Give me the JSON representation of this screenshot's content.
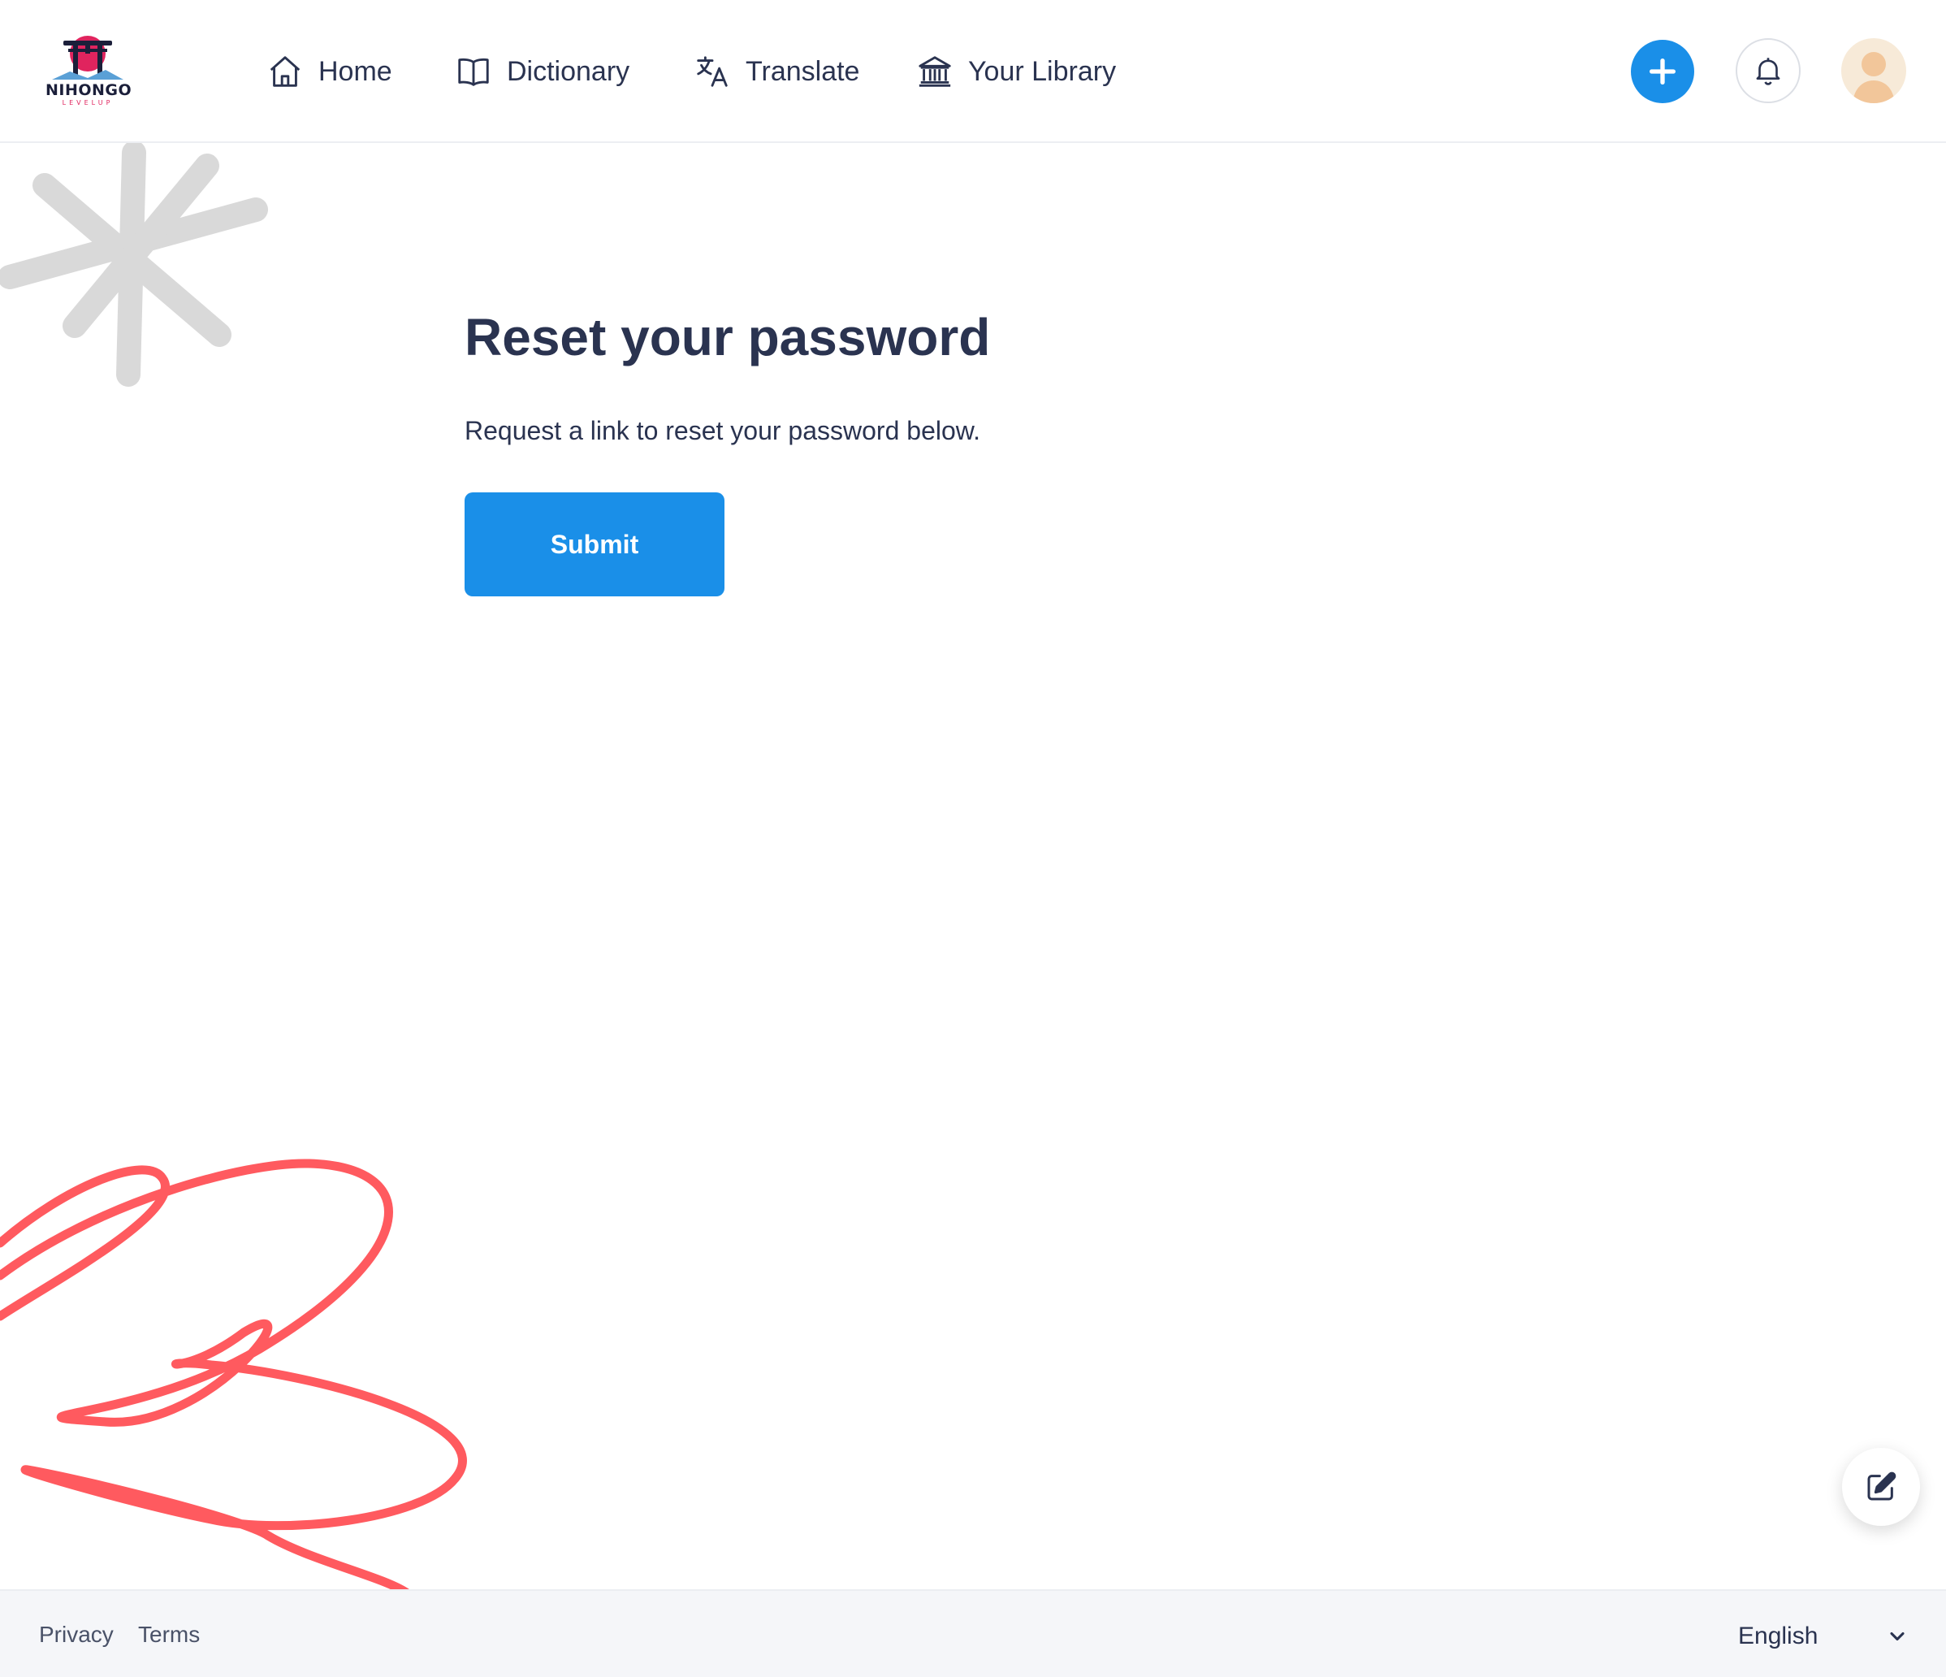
{
  "app": {
    "logo_text": "NIHONGO",
    "logo_subtext": "LEVELUP"
  },
  "nav": {
    "items": [
      {
        "label": "Home",
        "icon": "home-icon"
      },
      {
        "label": "Dictionary",
        "icon": "book-icon"
      },
      {
        "label": "Translate",
        "icon": "translate-icon"
      },
      {
        "label": "Your Library",
        "icon": "library-icon"
      }
    ]
  },
  "header_actions": {
    "add_icon": "plus-icon",
    "notification_icon": "bell-icon",
    "avatar_icon": "user-avatar"
  },
  "main": {
    "title": "Reset your password",
    "subtitle": "Request a link to reset your password below.",
    "submit_label": "Submit"
  },
  "fab": {
    "icon": "edit-icon"
  },
  "footer": {
    "links": [
      "Privacy",
      "Terms"
    ],
    "language": "English"
  },
  "colors": {
    "primary": "#1a8fe8",
    "text": "#2a3350",
    "decoration_red": "#ff5a5f",
    "decoration_gray": "#d9d9d9",
    "footer_bg": "#f5f6f9"
  }
}
